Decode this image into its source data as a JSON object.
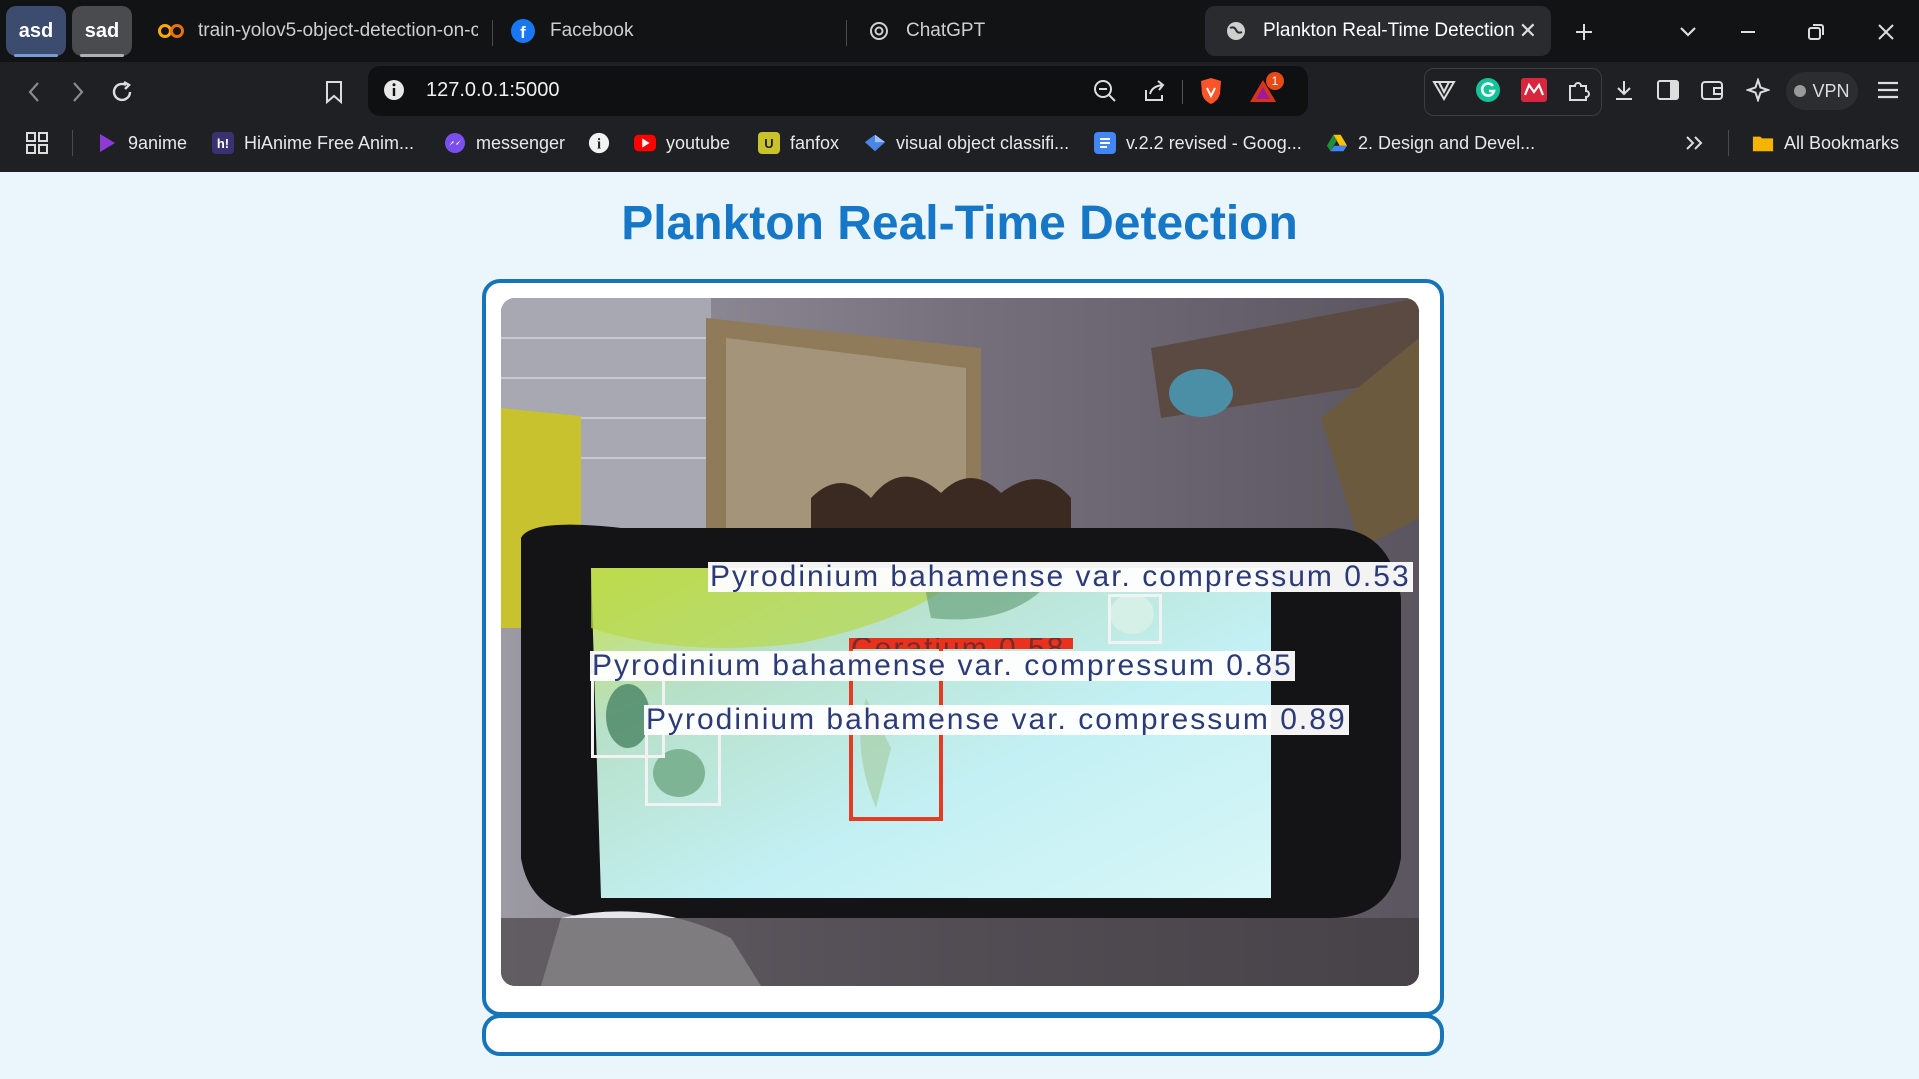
{
  "browser": {
    "tab_groups": [
      {
        "label": "asd",
        "color": "#3b4c6e"
      },
      {
        "label": "sad",
        "color": "#4a4b4f"
      }
    ],
    "tabs": [
      {
        "label": "train-yolov5-object-detection-on-c",
        "icon": "colab-icon"
      },
      {
        "label": "Facebook",
        "icon": "facebook-icon"
      },
      {
        "label": "ChatGPT",
        "icon": "chatgpt-icon"
      },
      {
        "label": "Plankton Real-Time Detection",
        "icon": "globe-icon",
        "active": true
      }
    ],
    "address": "127.0.0.1:5000",
    "brave_rewards_badge": "1",
    "vpn_label": "VPN",
    "bookmarks": [
      {
        "label": "9anime",
        "icon": "play-icon"
      },
      {
        "label": "HiAnime Free Anim...",
        "icon": "hianime-icon"
      },
      {
        "label": "messenger",
        "icon": "messenger-icon"
      },
      {
        "label": "",
        "icon": "info-icon"
      },
      {
        "label": "youtube",
        "icon": "youtube-icon"
      },
      {
        "label": "fanfox",
        "icon": "fanfox-icon"
      },
      {
        "label": "visual object classifi...",
        "icon": "diamond-icon"
      },
      {
        "label": "v.2.2 revised - Goog...",
        "icon": "docs-icon"
      },
      {
        "label": "2. Design and Devel...",
        "icon": "drive-icon"
      }
    ],
    "all_bookmarks_label": "All Bookmarks"
  },
  "page": {
    "title": "Plankton Real-Time Detection",
    "accent_color": "#1677c7",
    "border_color": "#1874b9",
    "background_color": "#eaf6fc"
  },
  "detections": [
    {
      "label": "Pyrodinium bahamense var. compressum 0.53",
      "color": "white"
    },
    {
      "label": "Ceratium 0.58",
      "color": "red"
    },
    {
      "label": "Pyrodinium bahamense var. compressum 0.85",
      "color": "white"
    },
    {
      "label": "Pyrodinium bahamense var. compressum 0.89",
      "color": "white"
    }
  ]
}
